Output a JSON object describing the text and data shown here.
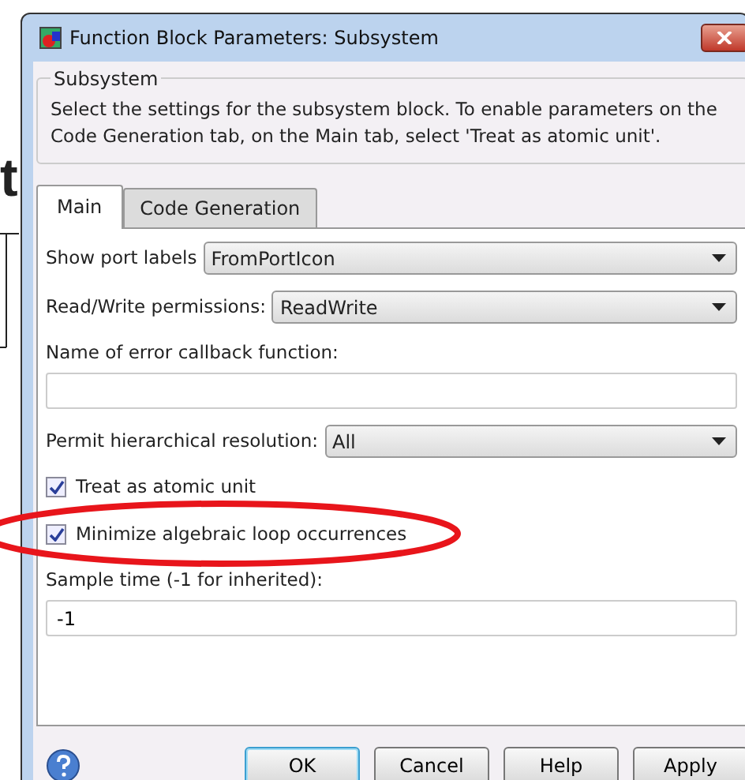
{
  "background": {
    "heading_fragment": "t"
  },
  "window": {
    "title": "Function Block Parameters: Subsystem"
  },
  "description_group": {
    "legend": "Subsystem",
    "text": "Select the settings for the subsystem block. To enable parameters on the Code Generation tab, on the Main tab, select 'Treat as atomic unit'."
  },
  "tabs": [
    {
      "label": "Main",
      "selected": true
    },
    {
      "label": "Code Generation",
      "selected": false
    }
  ],
  "fields": [
    {
      "kind": "select",
      "label": "Show port labels",
      "value": "FromPortIcon"
    },
    {
      "kind": "select",
      "label": "Read/Write permissions:",
      "value": "ReadWrite"
    },
    {
      "kind": "text",
      "label": "Name of error callback function:"
    },
    {
      "kind": "select",
      "label": "Permit hierarchical resolution:",
      "value": "All"
    },
    {
      "kind": "checkbox",
      "label": "Treat as atomic unit",
      "checked": true
    },
    {
      "kind": "checkbox",
      "label": "Minimize algebraic loop occurrences",
      "checked": true
    },
    {
      "kind": "text",
      "label": "Sample time (-1 for inherited):",
      "value": "-1"
    }
  ],
  "buttons": [
    {
      "label": "OK",
      "default": true
    },
    {
      "label": "Cancel",
      "default": false
    },
    {
      "label": "Help",
      "default": false
    },
    {
      "label": "Apply",
      "default": false
    }
  ]
}
